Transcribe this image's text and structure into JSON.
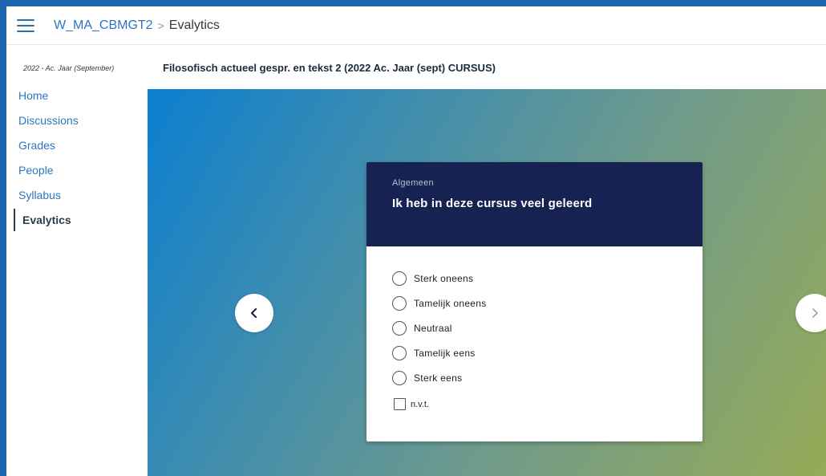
{
  "header": {
    "course_code": "W_MA_CBMGT2",
    "separator": ">",
    "current_page": "Evalytics"
  },
  "sidebar": {
    "term": "2022 - Ac. Jaar (September)",
    "items": [
      {
        "label": "Home"
      },
      {
        "label": "Discussions"
      },
      {
        "label": "Grades"
      },
      {
        "label": "People"
      },
      {
        "label": "Syllabus"
      },
      {
        "label": "Evalytics",
        "active": true
      }
    ]
  },
  "main": {
    "course_title": "Filosofisch actueel gespr. en tekst 2 (2022 Ac. Jaar (sept) CURSUS)"
  },
  "card": {
    "category": "Algemeen",
    "question": "Ik heb in deze cursus veel geleerd",
    "options": [
      {
        "label": "Sterk oneens"
      },
      {
        "label": "Tamelijk oneens"
      },
      {
        "label": "Neutraal"
      },
      {
        "label": "Tamelijk eens"
      },
      {
        "label": "Sterk eens"
      }
    ],
    "na_label": "n.v.t."
  },
  "navigation": {
    "prev_icon": "chevron-left-icon",
    "next_icon": "chevron-right-icon"
  },
  "colors": {
    "frame": "#1e67b0",
    "link": "#2b76c2",
    "card_header": "#162252",
    "gradient_start": "#0b7fd0",
    "gradient_end": "#96ab57"
  }
}
